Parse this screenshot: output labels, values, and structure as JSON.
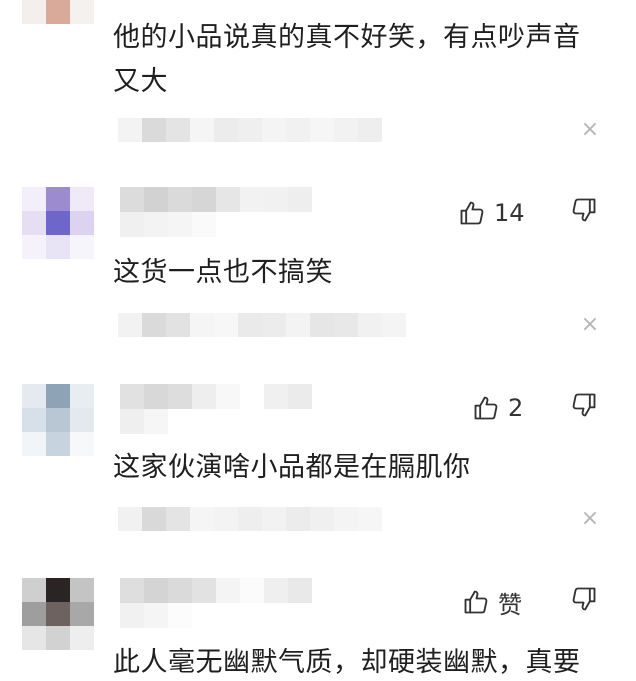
{
  "comments": [
    {
      "text_lines": [
        "他的小品说真的真不好笑，有点吵声音",
        "又大"
      ],
      "likes": null
    },
    {
      "text_lines": [
        "这货一点也不搞笑"
      ],
      "likes": "14"
    },
    {
      "text_lines": [
        "这家伙演啥小品都是在膈肌你"
      ],
      "likes": "2"
    },
    {
      "text_lines": [
        "此人毫无幽默气质，却硬装幽默，真要"
      ],
      "likes": "赞"
    }
  ],
  "icons": {
    "like": "thumbs-up-icon",
    "dislike": "thumbs-down-icon",
    "close": "close-icon"
  },
  "close_glyph": "×",
  "colors": {
    "text": "#1f1f1f",
    "icon": "#333333",
    "muted": "#b5b5b5"
  }
}
